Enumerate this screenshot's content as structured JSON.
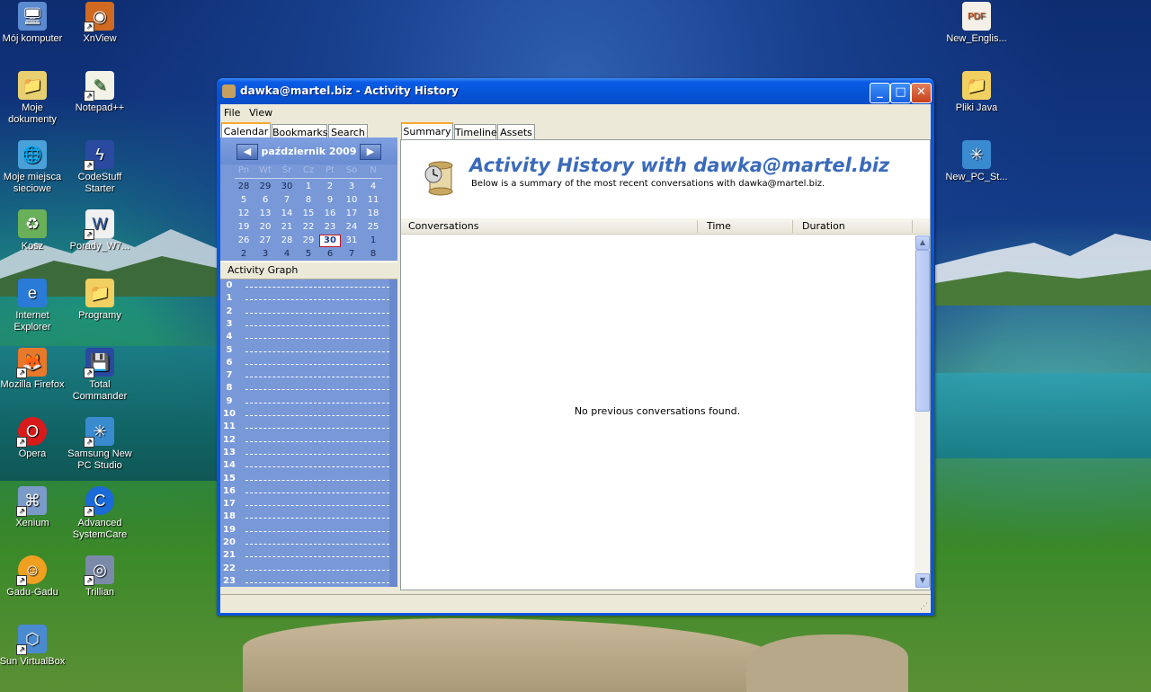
{
  "desktop": {
    "icons": [
      {
        "label": "Mój komputer",
        "icon": "computer-icon"
      },
      {
        "label": "XnView",
        "icon": "xnview-icon"
      },
      {
        "label": "Moje dokumenty",
        "icon": "documents-folder-icon"
      },
      {
        "label": "Notepad++",
        "icon": "notepad-icon"
      },
      {
        "label": "Moje miejsca sieciowe",
        "icon": "network-places-icon"
      },
      {
        "label": "CodeStuff Starter",
        "icon": "codestuff-icon"
      },
      {
        "label": "Kosz",
        "icon": "recycle-bin-icon"
      },
      {
        "label": "Porady_W7...",
        "icon": "word-document-icon"
      },
      {
        "label": "Internet Explorer",
        "icon": "internet-explorer-icon"
      },
      {
        "label": "Programy",
        "icon": "folder-icon"
      },
      {
        "label": "Mozilla Firefox",
        "icon": "firefox-icon"
      },
      {
        "label": "Total Commander",
        "icon": "total-commander-icon"
      },
      {
        "label": "Opera",
        "icon": "opera-icon"
      },
      {
        "label": "Samsung New PC Studio",
        "icon": "samsung-pc-studio-icon"
      },
      {
        "label": "Xenium",
        "icon": "xenium-icon"
      },
      {
        "label": "Advanced SystemCare",
        "icon": "advanced-systemcare-icon"
      },
      {
        "label": "Gadu-Gadu",
        "icon": "gadu-gadu-icon"
      },
      {
        "label": "Trillian",
        "icon": "trillian-icon"
      },
      {
        "label": "Sun VirtualBox",
        "icon": "virtualbox-icon"
      },
      {
        "label": "New_Englis...",
        "icon": "pdf-icon"
      },
      {
        "label": "Pliki Java",
        "icon": "folder-icon"
      },
      {
        "label": "New_PC_St...",
        "icon": "samsung-pc-studio-icon"
      }
    ]
  },
  "window": {
    "title": "dawka@martel.biz - Activity History",
    "minimize_label": "_",
    "maximize_label": "□",
    "close_label": "✕"
  },
  "menu": {
    "file": "File",
    "view": "View"
  },
  "left_tabs": {
    "calendar": "Calendar",
    "bookmarks": "Bookmarks",
    "search": "Search"
  },
  "calendar": {
    "month": "październik 2009",
    "prev": "◀",
    "next": "▶",
    "weekdays": [
      "Pn",
      "Wt",
      "Śr",
      "Cz",
      "Pt",
      "So",
      "N"
    ],
    "weeks": [
      [
        "28",
        "29",
        "30",
        "1",
        "2",
        "3",
        "4"
      ],
      [
        "5",
        "6",
        "7",
        "8",
        "9",
        "10",
        "11"
      ],
      [
        "12",
        "13",
        "14",
        "15",
        "16",
        "17",
        "18"
      ],
      [
        "19",
        "20",
        "21",
        "22",
        "23",
        "24",
        "25"
      ],
      [
        "26",
        "27",
        "28",
        "29",
        "30",
        "31",
        "1"
      ],
      [
        "2",
        "3",
        "4",
        "5",
        "6",
        "7",
        "8"
      ]
    ],
    "selected_day": "30"
  },
  "activity_graph": {
    "title": "Activity Graph",
    "hours": [
      "0",
      "1",
      "2",
      "3",
      "4",
      "5",
      "6",
      "7",
      "8",
      "9",
      "10",
      "11",
      "12",
      "13",
      "14",
      "15",
      "16",
      "17",
      "18",
      "19",
      "20",
      "21",
      "22",
      "23"
    ]
  },
  "right_tabs": {
    "summary": "Summary",
    "timeline": "Timeline",
    "assets": "Assets"
  },
  "summary": {
    "title": "Activity History with dawka@martel.biz",
    "subtitle": "Below is a summary of the most recent conversations with dawka@martel.biz.",
    "columns": {
      "conversations": "Conversations",
      "time": "Time",
      "duration": "Duration"
    },
    "empty_message": "No previous conversations found."
  }
}
